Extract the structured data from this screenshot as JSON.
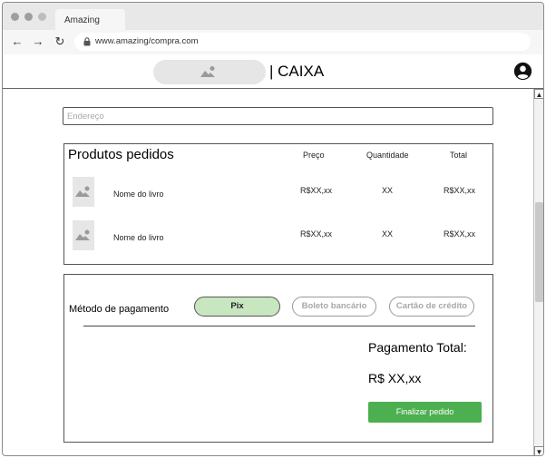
{
  "browser": {
    "tab_title": "Amazing",
    "url": "www.amazing/compra.com",
    "icons": {
      "back": "arrow-left-icon",
      "forward": "arrow-right-icon",
      "reload": "reload-icon",
      "lock": "lock-icon"
    }
  },
  "header": {
    "logo_icon": "image-placeholder-icon",
    "title": "| CAIXA",
    "user_icon": "user-account-icon"
  },
  "address": {
    "placeholder": "Endereço",
    "value": ""
  },
  "products": {
    "title": "Produtos pedidos",
    "columns": [
      "Preço",
      "Quantidade",
      "Total"
    ],
    "rows": [
      {
        "name": "Nome do livro",
        "price": "R$XX,xx",
        "quantity": "XX",
        "total": "R$XX,xx"
      },
      {
        "name": "Nome do livro",
        "price": "R$XX,xx",
        "quantity": "XX",
        "total": "R$XX,xx"
      }
    ]
  },
  "payment": {
    "label": "Método de pagamento",
    "methods": [
      {
        "label": "Pix",
        "selected": true
      },
      {
        "label": "Boleto bancário",
        "selected": false
      },
      {
        "label": "Cartão de crédito",
        "selected": false
      }
    ],
    "total_label": "Pagamento Total:",
    "total_value": "R$ XX,xx",
    "finalize_label": "Finalizar pedido"
  },
  "colors": {
    "selected_method": "#c8e6c0",
    "finalize_button": "#4caf50"
  }
}
